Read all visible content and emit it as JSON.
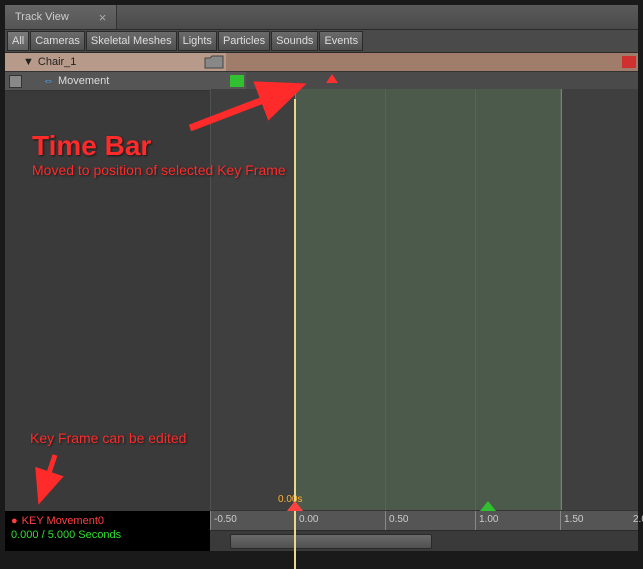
{
  "window": {
    "title": "Track View"
  },
  "filters": [
    "All",
    "Cameras",
    "Skeletal Meshes",
    "Lights",
    "Particles",
    "Sounds",
    "Events"
  ],
  "tracks": {
    "group": {
      "name": "Chair_1"
    },
    "sub": {
      "name": "Movement"
    }
  },
  "timeline": {
    "current_label": "0.00s",
    "ticks": [
      "-0.50",
      "0.00",
      "0.50",
      "1.00",
      "1.50",
      "2.0"
    ]
  },
  "status": {
    "key": "KEY Movement0",
    "time": "0.000 / 5.000 Seconds"
  },
  "annotations": {
    "time_bar": "Time Bar",
    "time_bar_sub": "Moved to position of selected Key Frame",
    "keyframe_edit": "Key Frame can be edited"
  }
}
